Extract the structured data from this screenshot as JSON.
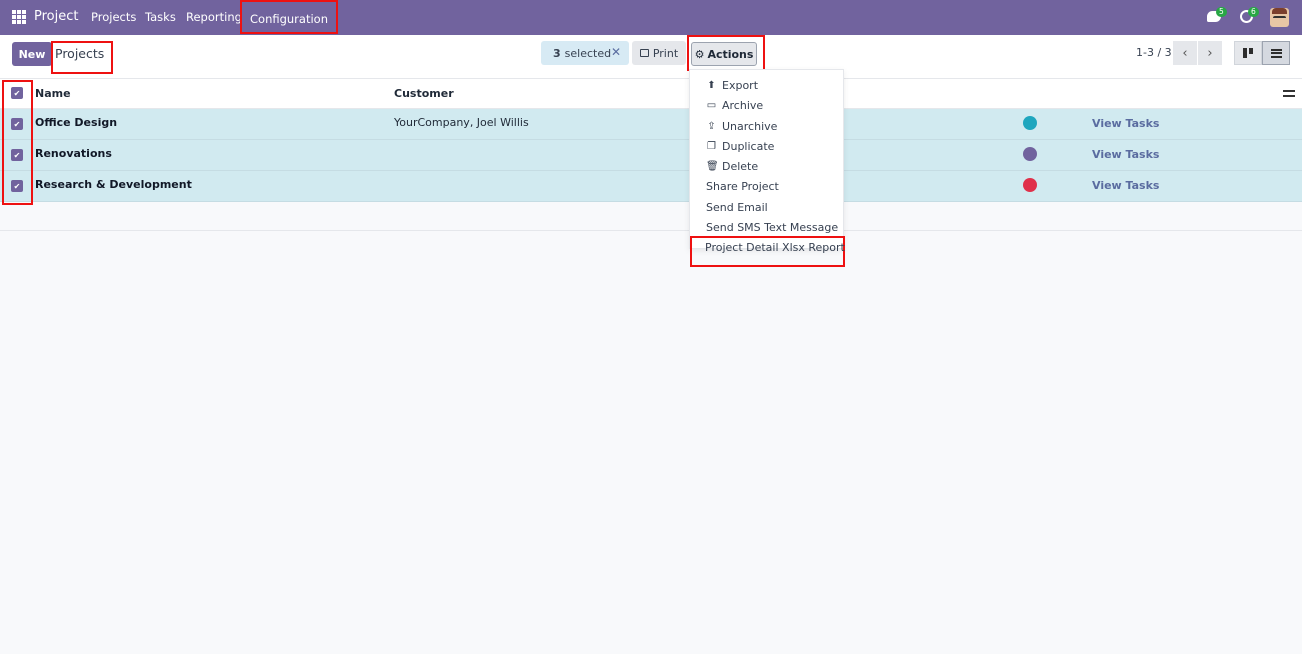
{
  "navbar": {
    "brand": "Project",
    "menu": [
      "Projects",
      "Tasks",
      "Reporting",
      "Configuration"
    ],
    "messages_count": "5",
    "activities_count": "6",
    "accent": "#71639e"
  },
  "control": {
    "new_label": "New",
    "breadcrumb": "Projects",
    "selected_count": "3",
    "selected_label": "selected",
    "print_label": "Print",
    "actions_label": "Actions",
    "pager": "1-3 / 3"
  },
  "table": {
    "columns": [
      "Name",
      "Customer"
    ],
    "rows": [
      {
        "name": "Office Design",
        "customer": "YourCompany, Joel Willis",
        "color": "#1ea6be",
        "link": "View Tasks"
      },
      {
        "name": "Renovations",
        "customer": "",
        "color": "#71639e",
        "link": "View Tasks"
      },
      {
        "name": "Research & Development",
        "customer": "",
        "color": "#e0304a",
        "link": "View Tasks"
      }
    ]
  },
  "actions_menu": {
    "items": [
      {
        "label": "Export",
        "icon": "upload-icon"
      },
      {
        "label": "Archive",
        "icon": "archive-icon"
      },
      {
        "label": "Unarchive",
        "icon": "unarchive-icon"
      },
      {
        "label": "Duplicate",
        "icon": "copy-icon"
      },
      {
        "label": "Delete",
        "icon": "trash-icon"
      },
      {
        "label": "Share Project",
        "icon": ""
      },
      {
        "label": "Send Email",
        "icon": ""
      },
      {
        "label": "Send SMS Text Message",
        "icon": ""
      }
    ],
    "report": "Project Detail Xlsx Report"
  }
}
